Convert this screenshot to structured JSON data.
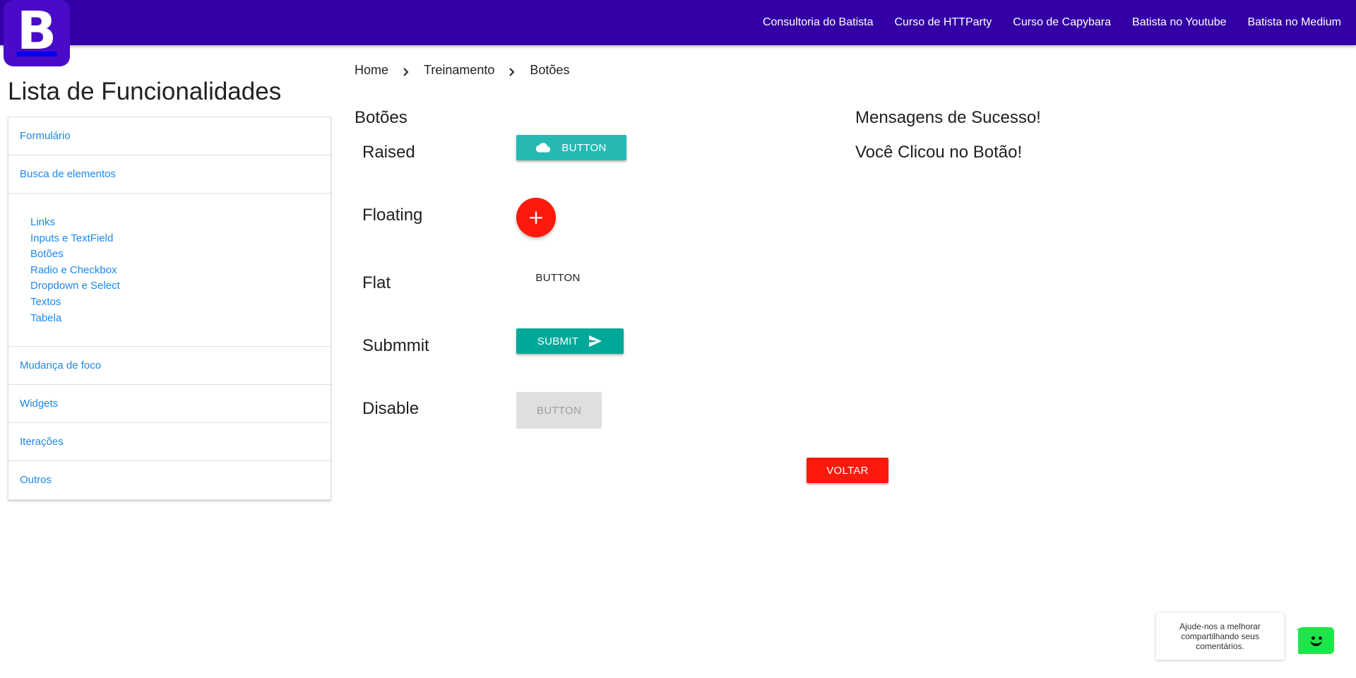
{
  "logo": {
    "letter": "B"
  },
  "topnav": {
    "links": [
      "Consultoria do Batista",
      "Curso de HTTParty",
      "Curso de Capybara",
      "Batista no Youtube",
      "Batista no Medium"
    ]
  },
  "sidebar": {
    "title": "Lista de Funcionalidades",
    "items_top": [
      "Formulário",
      "Busca de elementos"
    ],
    "sub_items": [
      "Links",
      "Inputs e TextField",
      "Botões",
      "Radio e Checkbox",
      "Dropdown e Select",
      "Textos",
      "Tabela"
    ],
    "items_bottom": [
      "Mudança de foco",
      "Widgets",
      "Iterações",
      "Outros"
    ]
  },
  "breadcrumb": [
    "Home",
    "Treinamento",
    "Botões"
  ],
  "buttons_section": {
    "title": "Botões",
    "rows": {
      "raised": {
        "label": "Raised",
        "button": "BUTTON"
      },
      "floating": {
        "label": "Floating",
        "button": "+"
      },
      "flat": {
        "label": "Flat",
        "button": "BUTTON"
      },
      "submit": {
        "label": "Submmit",
        "button": "SUBMIT"
      },
      "disable": {
        "label": "Disable",
        "button": "BUTTON"
      }
    },
    "back_button": "VOLTAR"
  },
  "success": {
    "title": "Mensagens de Sucesso!",
    "message": "Você Clicou no Botão!"
  },
  "feedback": {
    "text": "Ajude-nos a melhorar compartilhando seus comentários."
  },
  "colors": {
    "topbar": "#3300a6",
    "logo": "#4a0bc9",
    "link": "#1e88e5",
    "raised": "#26b9b3",
    "submit": "#00a89a",
    "danger": "#fb1a0c",
    "disabled": "#dfdfdf",
    "feedback": "#1ee54a"
  }
}
